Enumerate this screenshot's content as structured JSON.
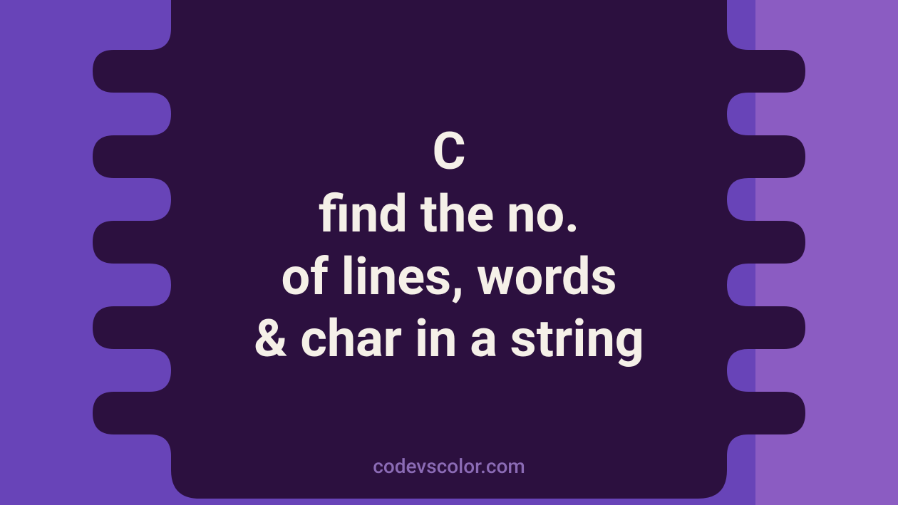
{
  "title": {
    "line1": "C",
    "line2": "find the no.",
    "line3": "of lines, words",
    "line4": "& char in a string"
  },
  "footer": "codevscolor.com"
}
